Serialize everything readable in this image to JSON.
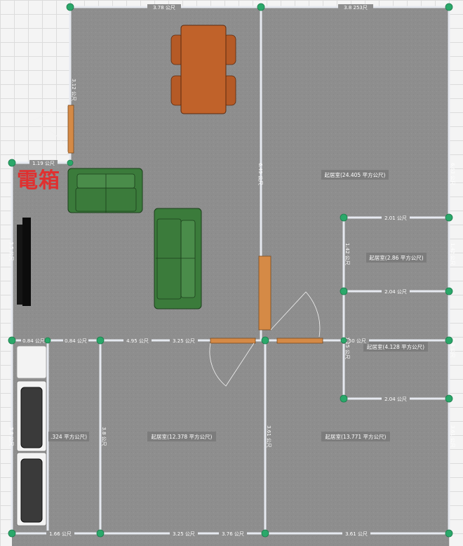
{
  "annotation": {
    "text": "電箱",
    "color": "#e03030"
  },
  "colors": {
    "floor": "#8d8d8d",
    "wall": "#e6e9f0",
    "node": "#2aa86a",
    "door": "#d58a46",
    "sofa": "#3a7a3a",
    "table": "#c0622a",
    "tv": "#111111"
  },
  "rooms": [
    {
      "id": "r1",
      "label": "起居室(24.405 平方公尺)"
    },
    {
      "id": "r2",
      "label": "起居室(2.86 平方公尺)"
    },
    {
      "id": "r3",
      "label": "起居室(4.128 平方公尺)"
    },
    {
      "id": "r4",
      "label": "起居室(12.378 平方公尺)"
    },
    {
      "id": "r5",
      "label": "起居室(13.771 平方公尺)"
    },
    {
      "id": "r6",
      "label": ".324 平方公尺)"
    }
  ],
  "dimensions": {
    "top_left": "3.78 公尺",
    "top_right": "3.8 253尺",
    "left_upper": "3.12 公尺",
    "door_width": "1.19 公尺",
    "center_wall": "6.49 公尺",
    "tv_wall": "3.5 公尺",
    "right_wall_upper": "6.63 公尺",
    "small_room_top": "2.01 公尺",
    "small_room_left": "1.42 公尺",
    "small_room_right": "1.42 公尺",
    "small_room_bottom": "2.04 公尺",
    "mid_row_a": "0.84 公尺",
    "mid_row_b": "0.84 公尺",
    "mid_row_c": "4.95 公尺",
    "mid_row_d": "3.25 公尺",
    "mid_row_e": "1.50 公尺",
    "right_small_left": "1.25 公尺",
    "right_small_right": "1.8 公尺",
    "right_small_bottom": "2.04 公尺",
    "left_lower": "3.8 公尺",
    "bottom_left_div": "3.8 公尺",
    "bottom_center_div": "3.61 公尺",
    "right_lower": "3.61 公尺",
    "bottom_a": "1.66 公尺",
    "bottom_b": "3.25 公尺",
    "bottom_c": "3.76 公尺",
    "bottom_d": "3.61 公尺"
  }
}
